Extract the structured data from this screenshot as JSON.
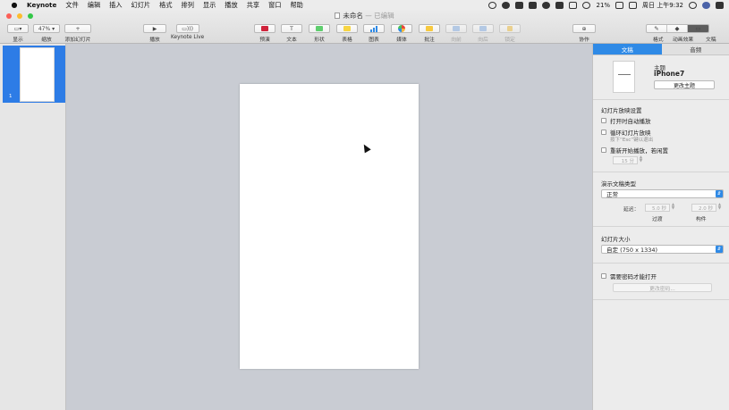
{
  "menubar": {
    "apple": "",
    "app_name": "Keynote",
    "items": [
      "文件",
      "编辑",
      "插入",
      "幻灯片",
      "格式",
      "排列",
      "显示",
      "播放",
      "共享",
      "窗口",
      "帮助"
    ],
    "battery": "21%",
    "clock": "周日 上午9:32"
  },
  "window": {
    "title": "未命名",
    "edited_suffix": "— 已编辑"
  },
  "toolbar": {
    "view": {
      "icon": "▭▾",
      "label": "显示"
    },
    "zoom": {
      "value": "47%",
      "label": "缩放"
    },
    "add_slide": {
      "icon": "+",
      "label": "添加幻灯片"
    },
    "play": {
      "icon": "▶",
      "label": "播放"
    },
    "keynote_live": {
      "icon": "▭)))",
      "label": "Keynote Live"
    },
    "insert": [
      {
        "label": "预演"
      },
      {
        "icon": "T",
        "label": "文本"
      },
      {
        "label": "形状"
      },
      {
        "label": "表格"
      },
      {
        "label": "图表"
      },
      {
        "label": "媒体"
      },
      {
        "label": "批注"
      },
      {
        "label": "向前"
      },
      {
        "label": "向后"
      },
      {
        "label": "锁定"
      }
    ],
    "collaborate": {
      "icon": "⊕",
      "label": "协作"
    },
    "right_tabs": [
      {
        "icon": "✎",
        "label": "格式"
      },
      {
        "icon": "◆",
        "label": "动画效果"
      },
      {
        "icon": "▭",
        "label": "文稿"
      }
    ]
  },
  "navigator": {
    "slide_number": "1"
  },
  "inspector": {
    "tabs": [
      "文稿",
      "音频"
    ],
    "theme": {
      "label": "主题",
      "name": "iPhone7",
      "change_button": "更改主题"
    },
    "slideshow": {
      "heading": "幻灯片放映设置",
      "autoplay": "打开时自动播放",
      "loop": "循环幻灯片放映",
      "loop_hint": "按下“Esc”键以退出",
      "restart_idle": "重新开始播放，若闲置",
      "idle_minutes": "15 分"
    },
    "presentation": {
      "heading": "演示文稿类型",
      "type_value": "正常",
      "delay_label": "延迟：",
      "transition_value": "5.0 秒",
      "transition_label": "过渡",
      "build_value": "2.0 秒",
      "build_label": "构件"
    },
    "slide_size": {
      "heading": "幻灯片大小",
      "value": "自定 (750 x 1334)"
    },
    "password": {
      "require": "需要密码才能打开",
      "change_button": "更改密码..."
    }
  },
  "colors": {
    "accent": "#2f8ae6",
    "canvas": "#c9ccd3"
  }
}
